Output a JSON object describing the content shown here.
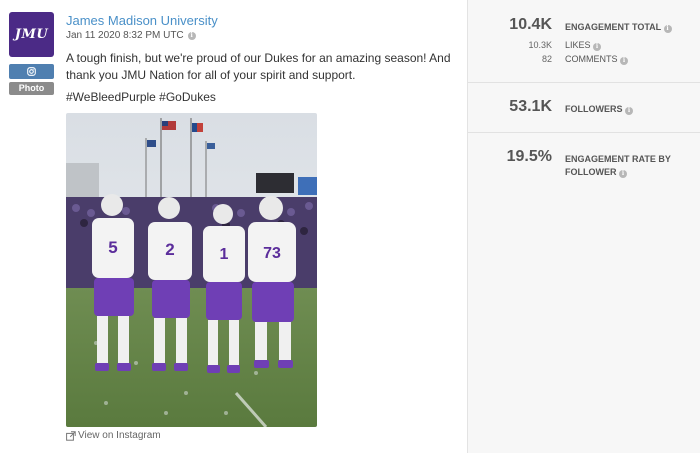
{
  "post": {
    "author": "James Madison University",
    "avatar_text": "JMU",
    "network_icon": "instagram-icon",
    "type_badge": "Photo",
    "timestamp": "Jan 11 2020 8:32 PM UTC",
    "message": "A tough finish, but we're proud of our Dukes for an amazing season! And thank you JMU Nation for all of your spirit and support.",
    "hashtags": "#WeBleedPurple #GoDukes",
    "view_link": "View on Instagram",
    "jerseys": [
      "5",
      "2",
      "1",
      "73"
    ]
  },
  "metrics": {
    "engagement_total": {
      "value": "10.4K",
      "label": "ENGAGEMENT TOTAL"
    },
    "likes": {
      "value": "10.3K",
      "label": "LIKES"
    },
    "comments": {
      "value": "82",
      "label": "COMMENTS"
    },
    "followers": {
      "value": "53.1K",
      "label": "FOLLOWERS"
    },
    "engagement_rate": {
      "value": "19.5%",
      "label_line1": "ENGAGEMENT RATE BY",
      "label_line2": "FOLLOWER"
    }
  },
  "colors": {
    "brand_purple": "#4b2a86",
    "link_blue": "#4a90c8",
    "instagram_badge": "#4f7fb0"
  }
}
